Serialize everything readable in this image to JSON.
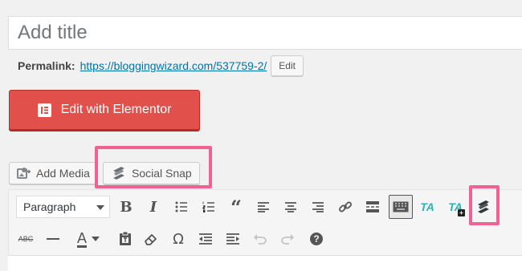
{
  "title_field": {
    "placeholder": "Add title"
  },
  "permalink": {
    "label": "Permalink:",
    "url": "https://bloggingwizard.com/537759-2/",
    "edit_label": "Edit"
  },
  "elementor": {
    "label": "Edit with Elementor",
    "color": "#e2504b"
  },
  "media_buttons": [
    {
      "label": "Add Media",
      "icon": "add-media-icon"
    },
    {
      "label": "Social Snap",
      "icon": "social-snap-icon"
    }
  ],
  "toolbar": {
    "format_select": "Paragraph",
    "row1": [
      "bold",
      "italic",
      "bulleted-list",
      "numbered-list",
      "blockquote",
      "align-left",
      "align-center",
      "align-right",
      "insert-link",
      "read-more",
      "toolbar-toggle",
      "thirstyaffiliates",
      "thirstyaffiliates-add",
      "social-snap"
    ],
    "row2": [
      "strikethrough",
      "horizontal-line",
      "text-color",
      "paste-as-text",
      "clear-formatting",
      "special-character",
      "outdent",
      "indent",
      "undo",
      "redo",
      "help"
    ],
    "bold_glyph": "B",
    "italic_glyph": "I",
    "ta_glyph": "TA",
    "omega_glyph": "Ω",
    "text_color_glyph": "A",
    "strike_glyph": "ABC",
    "help_glyph": "?"
  },
  "highlight_color": "#f06292"
}
